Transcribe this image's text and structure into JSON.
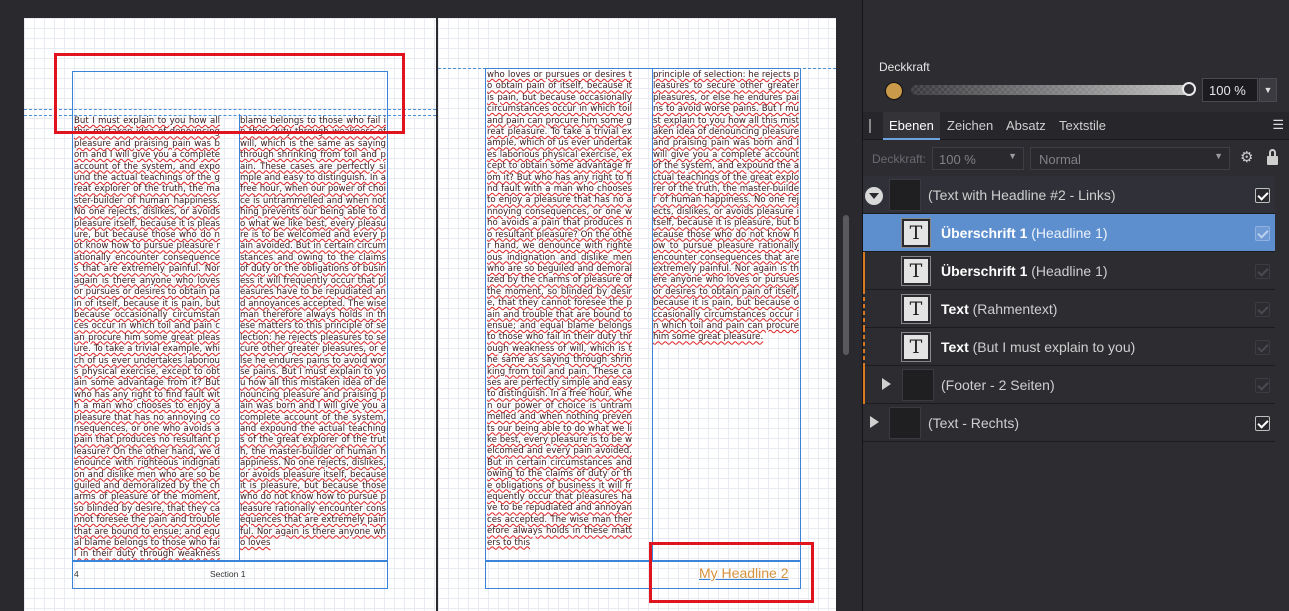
{
  "canvas": {
    "left_columns": {
      "col1_text": "But I must explain to you how all this mistaken idea of denouncing pleasure and praising pain was born and I will give you a complete account of the system, and expound the actual teachings of the great explorer of the truth, the master-builder of human happiness. No one rejects, dislikes, or avoids pleasure itself, because it is pleasure, but because those who do not know how to pursue pleasure rationally encounter consequences that are extremely painful. Nor again is there anyone who loves or pursues or desires to obtain pain of itself, because it is pain, but because occasionally circumstances occur in which toil and pain can procure him some great pleasure. To take a trivial example, which of us ever undertakes laborious physical exercise, except to obtain some advantage from it? But who has any right to find fault with a man who chooses to enjoy a pleasure that has no annoying consequences, or one who avoids a pain that produces no resultant pleasure? On the other hand, we denounce with righteous indignation and dislike men who are so beguiled and demoralized by the charms of pleasure of the moment, so blinded by desire, that they cannot foresee the pain and trouble that are bound to ensue; and equal blame belongs to those who fail in their duty through weakness of will.",
      "col2_text": "blame belongs to those who fail in their duty through weakness of will, which is the same as saying through shrinking from toil and pain. These cases are perfectly simple and easy to distinguish. In a free hour, when our power of choice is untrammelled and when nothing prevents our being able to do what we like best, every pleasure is to be welcomed and every pain avoided. But in certain circumstances and owing to the claims of duty or the obligations of business it will frequently occur that pleasures have to be repudiated and annoyances accepted. The wise man therefore always holds in these matters to this principle of selection: he rejects pleasures to secure other greater pleasures, or else he endures pains to avoid worse pains. But I must explain to you how all this mistaken idea of denouncing pleasure and praising pain was born and I will give you a complete account of the system, and expound the actual teachings of the great explorer of the truth, the master-builder of human happiness. No one rejects, dislikes, or avoids pleasure itself, because it is pleasure, but because those who do not know how to pursue pleasure rationally encounter consequences that are extremely painful. Nor again is there anyone who loves"
    },
    "left_footer": {
      "page_marker": "4",
      "section_label": "Section 1"
    },
    "right_columns": {
      "col1_text": "who loves or pursues or desires to obtain pain of itself, because it is pain, but because occasionally circumstances occur in which toil and pain can procure him some great pleasure. To take a trivial example, which of us ever undertakes laborious physical exercise, except to obtain some advantage from it? But who has any right to find fault with a man who chooses to enjoy a pleasure that has no annoying consequences, or one who avoids a pain that produces no resultant pleasure? On the other hand, we denounce with righteous indignation and dislike men who are so beguiled and demoralized by the charms of pleasure of the moment, so blinded by desire, that they cannot foresee the pain and trouble that are bound to ensue; and equal blame belongs to those who fail in their duty through weakness of will, which is the same as saying through shrinking from toil and pain. These cases are perfectly simple and easy to distinguish. In a free hour, when our power of choice is untrammelled and when nothing prevents our being able to do what we like best, every pleasure is to be welcomed and every pain avoided. But in certain circumstances and owing to the claims of duty or the obligations of business it will frequently occur that pleasures have to be repudiated and annoyances accepted. The wise man therefore always holds in these matters to this",
      "col2_text": "principle of selection: he rejects pleasures to secure other greater pleasures, or else he endures pains to avoid worse pains. But I must explain to you how all this mistaken idea of denouncing pleasure and praising pain was born and I will give you a complete account of the system, and expound the actual teachings of the great explorer of the truth, the master-builder of human happiness. No one rejects, dislikes, or avoids pleasure itself, because it is pleasure, but because those who do not know how to pursue pleasure rationally encounter consequences that are extremely painful. Nor again is there anyone who loves or pursues or desires to obtain pain of itself, because it is pain, but because occasionally circumstances occur in which toil and pain can procure him some great pleasure."
    },
    "right_footer": {
      "headline": "My Headline 2"
    }
  },
  "panel": {
    "opacity_label": "Deckkraft",
    "opacity_value": "100 %",
    "opacity_color": "#c99a4a",
    "tabs": [
      "Ebenen",
      "Zeichen",
      "Absatz",
      "Textstile"
    ],
    "active_tab": "Ebenen",
    "layer_controls": {
      "opacity_label": "Deckkraft:",
      "opacity_value": "100 %",
      "blend_mode": "Normal"
    },
    "layers": [
      {
        "name": "(Text with Headline #2 - Links)",
        "type": "group",
        "expanded": true,
        "visible": true
      },
      {
        "bold": "Überschrift 1",
        "sub": " (Headline 1)",
        "type": "text",
        "selected": true,
        "visible": true
      },
      {
        "bold": "Überschrift 1",
        "sub": " (Headline 1)",
        "type": "text",
        "selected": false,
        "visible": true
      },
      {
        "bold": "Text",
        "sub": " (Rahmentext)",
        "type": "text",
        "selected": false,
        "visible": true
      },
      {
        "bold": "Text",
        "sub": " (But I must explain to you)",
        "type": "text",
        "selected": false,
        "visible": true
      },
      {
        "name": "(Footer - 2 Seiten)",
        "type": "group",
        "expanded": false,
        "visible": true
      },
      {
        "name": "(Text - Rechts)",
        "type": "group",
        "expanded": false,
        "visible": true
      }
    ]
  }
}
